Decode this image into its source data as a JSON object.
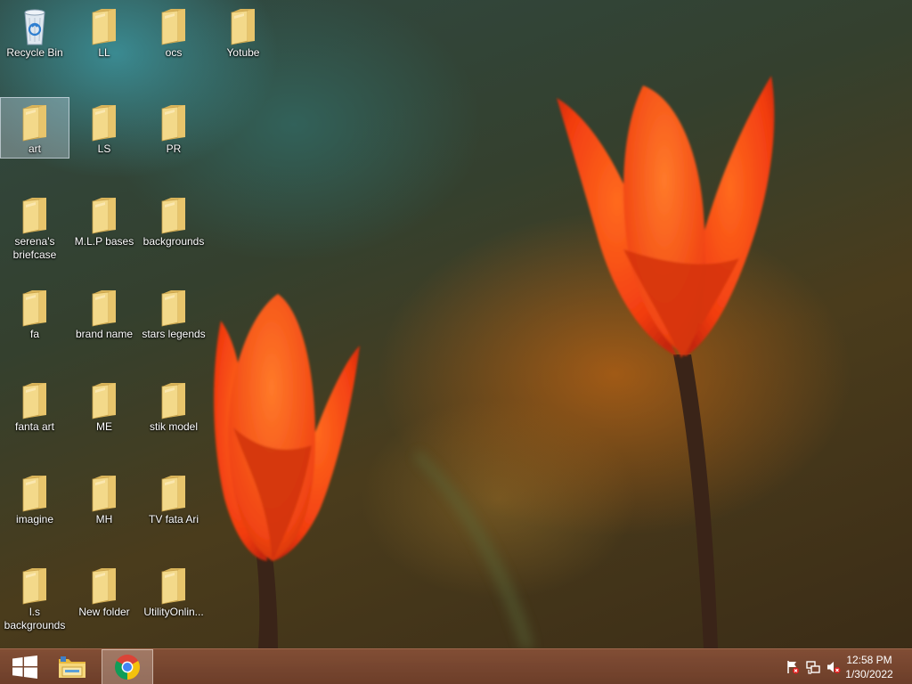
{
  "desktop": {
    "icons": [
      {
        "label": "Recycle Bin",
        "type": "recycle-bin"
      },
      {
        "label": "LL",
        "type": "folder"
      },
      {
        "label": "ocs",
        "type": "folder"
      },
      {
        "label": "Yotube",
        "type": "folder"
      },
      {
        "label": "art",
        "type": "folder",
        "selected": true
      },
      {
        "label": "LS",
        "type": "folder"
      },
      {
        "label": "PR",
        "type": "folder"
      },
      {
        "label": "serena's briefcase",
        "type": "folder"
      },
      {
        "label": "M.L.P bases",
        "type": "folder"
      },
      {
        "label": "backgrounds",
        "type": "folder"
      },
      {
        "label": "fa",
        "type": "folder"
      },
      {
        "label": "brand name",
        "type": "folder"
      },
      {
        "label": "stars legends",
        "type": "folder"
      },
      {
        "label": "fanta art",
        "type": "folder"
      },
      {
        "label": "ME",
        "type": "folder"
      },
      {
        "label": "stik  model",
        "type": "folder"
      },
      {
        "label": "imagine",
        "type": "folder"
      },
      {
        "label": "MH",
        "type": "folder"
      },
      {
        "label": "TV  fata Ari",
        "type": "folder"
      },
      {
        "label": "l.s backgrounds",
        "type": "folder"
      },
      {
        "label": "New folder",
        "type": "folder"
      },
      {
        "label": "UtilityOnlin...",
        "type": "folder"
      }
    ]
  },
  "taskbar": {
    "start_icon": "windows-logo-icon",
    "pinned": [
      {
        "name": "file-explorer-icon",
        "active": false
      },
      {
        "name": "chrome-icon",
        "active": true
      }
    ],
    "tray": {
      "icons": [
        "action-center-flag-icon",
        "network-icon",
        "volume-muted-icon"
      ],
      "time": "12:58 PM",
      "date": "1/30/2022"
    }
  },
  "colors": {
    "taskbar": "#7a4630",
    "folder": "#f2d27a",
    "tulip": "#ff4a12"
  }
}
